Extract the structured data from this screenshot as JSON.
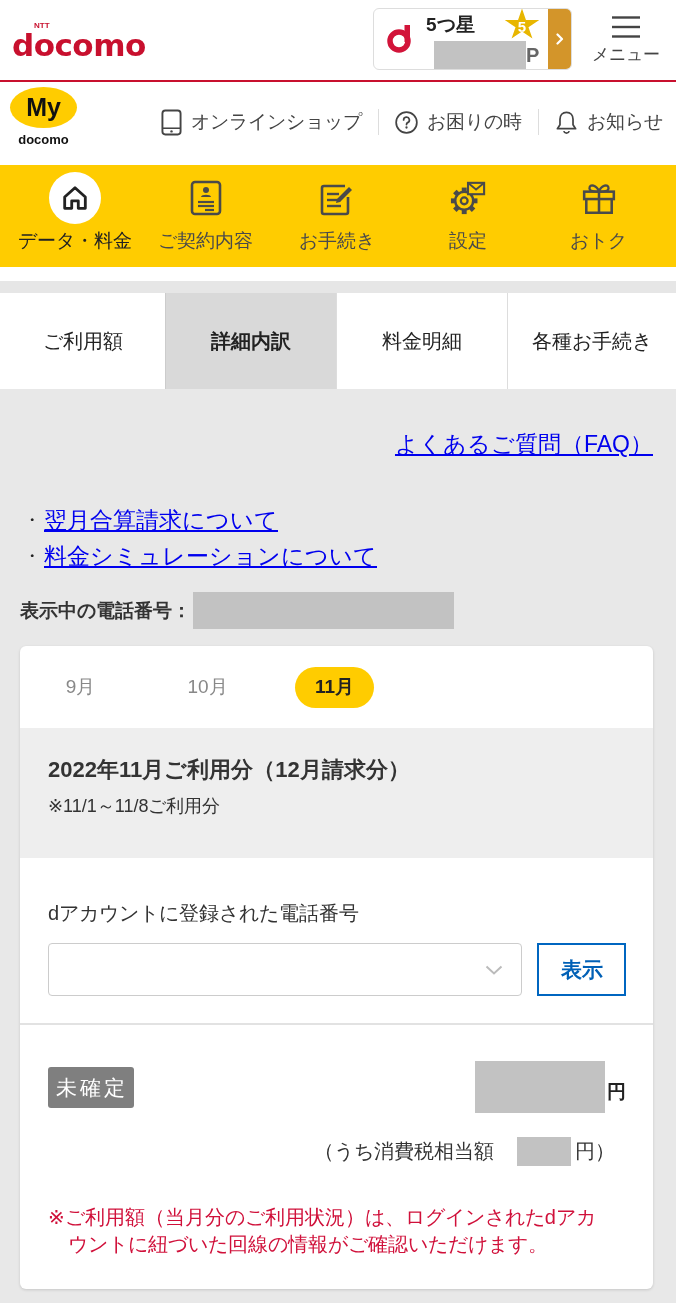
{
  "header": {
    "logo": {
      "small": "NTT",
      "name": "docomo"
    },
    "points": {
      "rank": "5つ星",
      "star": "5",
      "unit": "P"
    },
    "menu_label": "メニュー"
  },
  "sub_header": {
    "logo": {
      "badge": "My",
      "name": "docomo"
    },
    "links": [
      "オンラインショップ",
      "お困りの時",
      "お知らせ"
    ]
  },
  "main_nav": [
    {
      "label": "データ・料金",
      "selected": true
    },
    {
      "label": "ご契約内容",
      "selected": false
    },
    {
      "label": "お手続き",
      "selected": false
    },
    {
      "label": "設定",
      "selected": false
    },
    {
      "label": "おトク",
      "selected": false
    }
  ],
  "tabs": [
    {
      "label": "ご利用額",
      "selected": false
    },
    {
      "label": "詳細内訳",
      "selected": true
    },
    {
      "label": "料金明細",
      "selected": false
    },
    {
      "label": "各種お手続き",
      "selected": false
    }
  ],
  "faq_link": "よくあるご質問（FAQ）",
  "info_links": [
    {
      "bullet": "・",
      "label": "翌月合算請求について"
    },
    {
      "bullet": "・",
      "label": "料金シミュレーションについて"
    }
  ],
  "phone_number_label": "表示中の電話番号：",
  "card": {
    "months": [
      {
        "label": "9月",
        "selected": false
      },
      {
        "label": "10月",
        "selected": false
      },
      {
        "label": "11月",
        "selected": true
      }
    ],
    "period": {
      "title": "2022年11月ご利用分（12月請求分）",
      "note": "※11/1～11/8ご利用分"
    },
    "account_phone": {
      "label": "dアカウントに登録された電話番号",
      "button": "表示"
    },
    "amount": {
      "status": "未確定",
      "currency": "円",
      "tax_label": "（うち消費税相当額",
      "tax_currency": "円）"
    },
    "notice": "※ご利用額（当月分のご利用状況）は、ログインされたdアカウントに紐づいた回線の情報がご確認いただけます。"
  }
}
